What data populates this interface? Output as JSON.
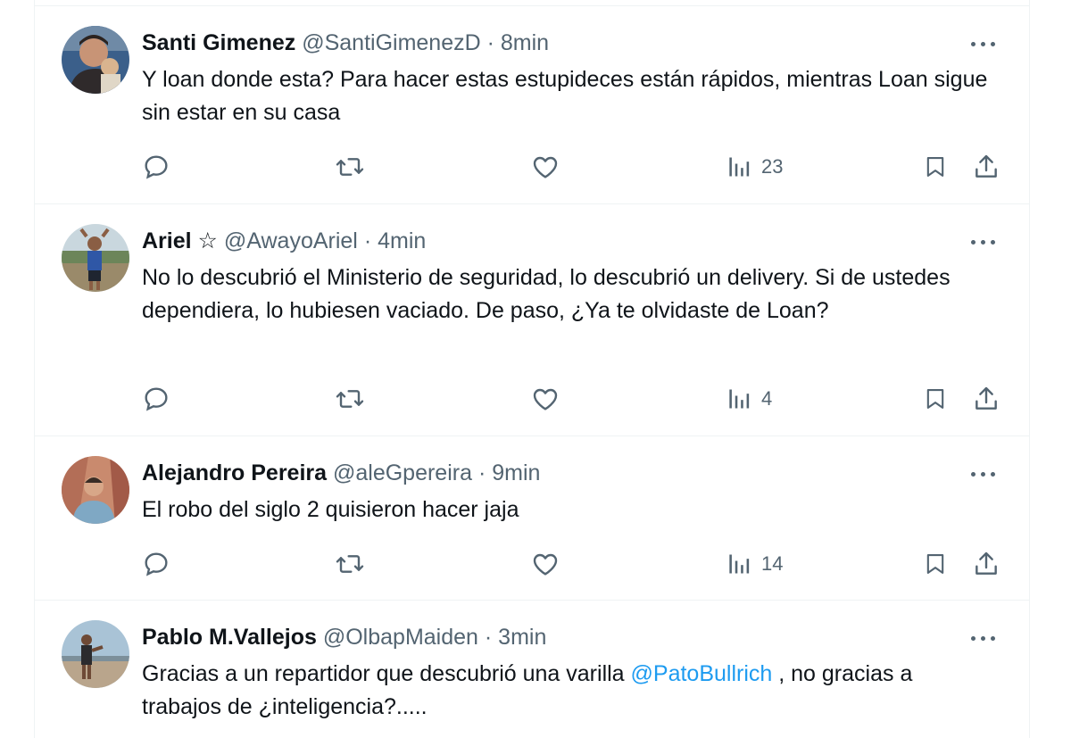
{
  "tweets": [
    {
      "name": "Santi Gimenez",
      "handle": "@SantiGimenezD",
      "time": "8min",
      "text": "Y loan donde esta? Para hacer estas estupideces están rápidos, mientras Loan sigue sin estar en su casa",
      "views": "23"
    },
    {
      "name": "Ariel ☆",
      "handle": "@AwayoAriel",
      "time": "4min",
      "text": "No lo descubrió el Ministerio de seguridad, lo descubrió un delivery. Si de ustedes dependiera, lo hubiesen vaciado. De paso, ¿Ya te olvidaste de Loan?",
      "views": "4"
    },
    {
      "name": "Alejandro Pereira",
      "handle": "@aleGpereira",
      "time": "9min",
      "text": "El robo del siglo 2 quisieron hacer jaja",
      "views": "14"
    },
    {
      "name": "Pablo M.Vallejos",
      "handle": "@OlbapMaiden",
      "time": "3min",
      "text_before": "Gracias a un repartidor que descubrió una varilla ",
      "mention": "@PatoBullrich",
      "text_after": " , no gracias a  trabajos de ¿inteligencia?....."
    }
  ],
  "separator": " · ",
  "icons": {
    "reply": "reply-icon",
    "retweet": "retweet-icon",
    "like": "like-icon",
    "views": "views-icon",
    "bookmark": "bookmark-icon",
    "share": "share-icon",
    "more": "more-icon"
  },
  "colors": {
    "text": "#0f1419",
    "secondary": "#536471",
    "link": "#1d9bf0",
    "border": "#eff3f4"
  }
}
